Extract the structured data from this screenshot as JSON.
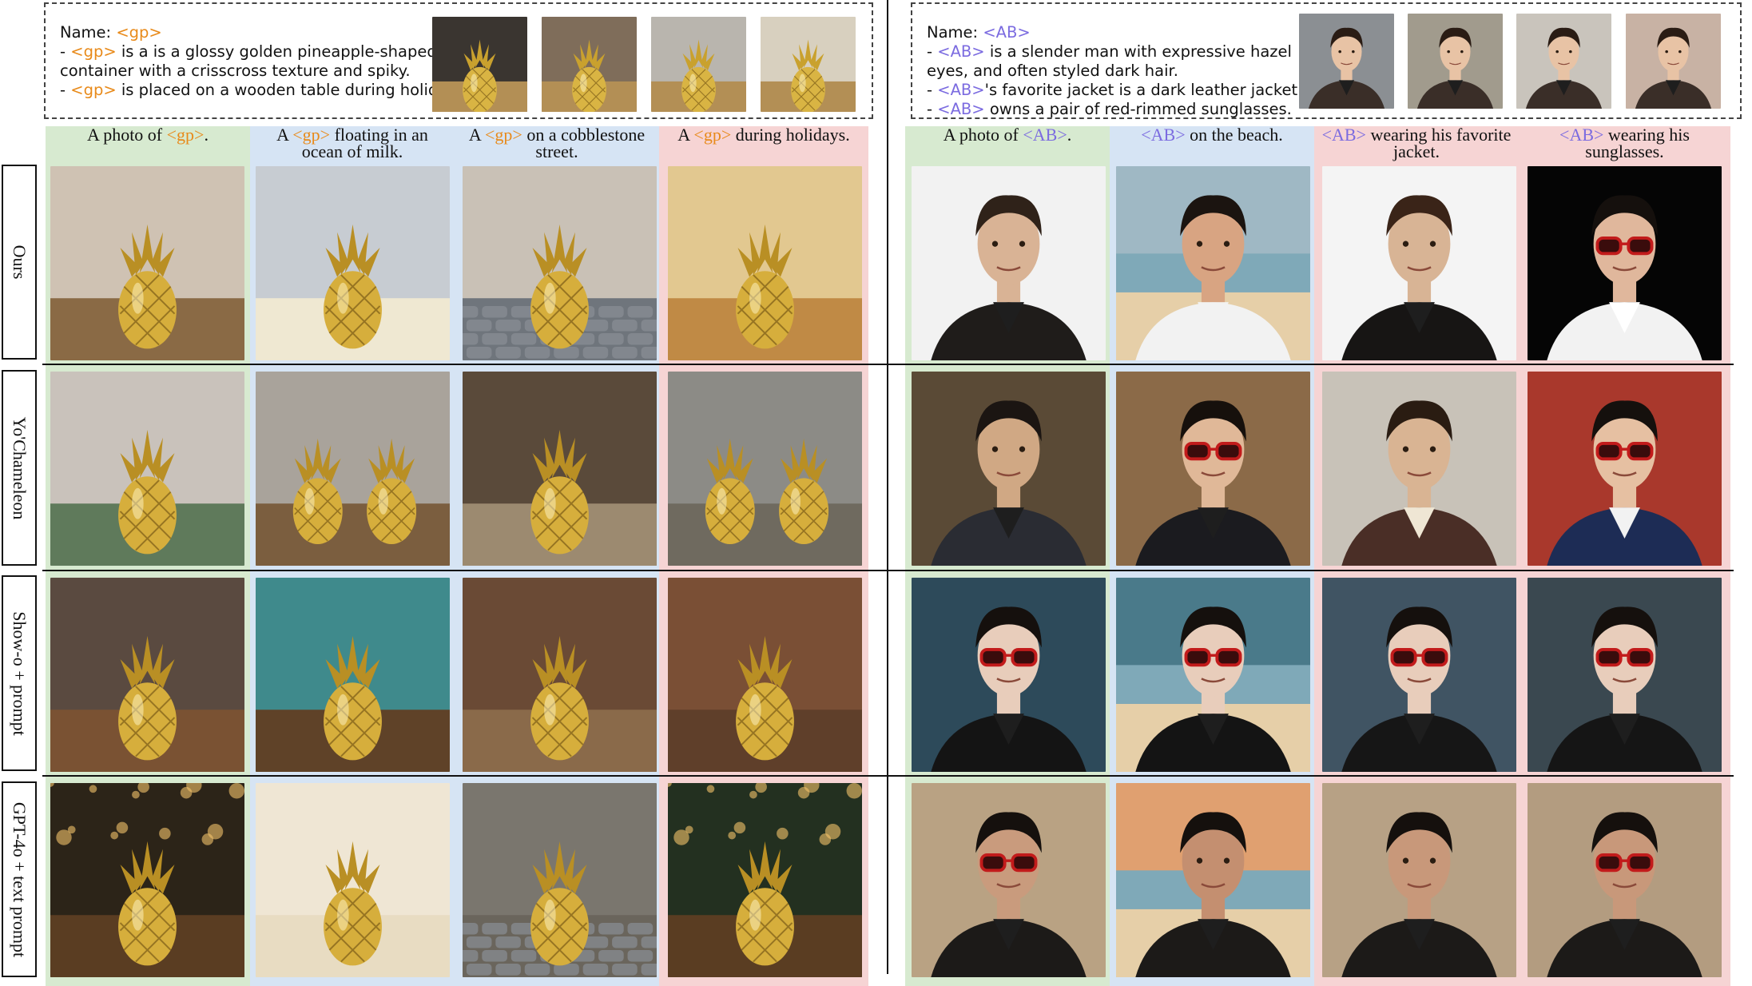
{
  "info_left": {
    "name_label": "Name:",
    "token": "<gp>",
    "line1_pre": "- ",
    "line1_post": " is a is a glossy golden pineapple-shaped",
    "line2": "container with a crisscross texture and spiky.",
    "line3_pre": "- ",
    "line3_post": " is placed on a wooden table during holidays."
  },
  "info_right": {
    "name_label": "Name:",
    "token": "<AB>",
    "line1_post": " is a slender man with expressive hazel",
    "line2": "eyes, and often styled dark hair.",
    "line3_post": "'s favorite jacket is a dark leather jacket.",
    "line4_post": " owns a pair of red-rimmed sunglasses."
  },
  "columns_left": [
    {
      "pre": "A photo of ",
      "tag": "<gp>",
      "post": "."
    },
    {
      "pre": "A ",
      "tag": "<gp>",
      "post": " floating in an",
      "line2": "ocean of milk."
    },
    {
      "pre": "A ",
      "tag": "<gp>",
      "post": " on a cobblestone",
      "line2": "street."
    },
    {
      "pre": "A ",
      "tag": "<gp>",
      "post": " during holidays."
    }
  ],
  "columns_right": [
    {
      "pre": "A photo of ",
      "tag": "<AB>",
      "post": "."
    },
    {
      "pre": "",
      "tag": "<AB>",
      "post": " on the beach."
    },
    {
      "pre": "",
      "tag": "<AB>",
      "post": " wearing his favorite",
      "line2": "jacket."
    },
    {
      "pre": "",
      "tag": "<AB>",
      "post": " wearing his",
      "line2": "sunglasses."
    }
  ],
  "rows": [
    "Ours",
    "Yo'Chameleon",
    "Show-o + prompt",
    "GPT-4o + text prompt"
  ],
  "colors": {
    "token_orange": "#e88a1a",
    "token_purple": "#7b6be0",
    "green_bg": "#d7ead0",
    "blue_bg": "#d6e4f4",
    "pink_bg": "#f6d4d4"
  }
}
